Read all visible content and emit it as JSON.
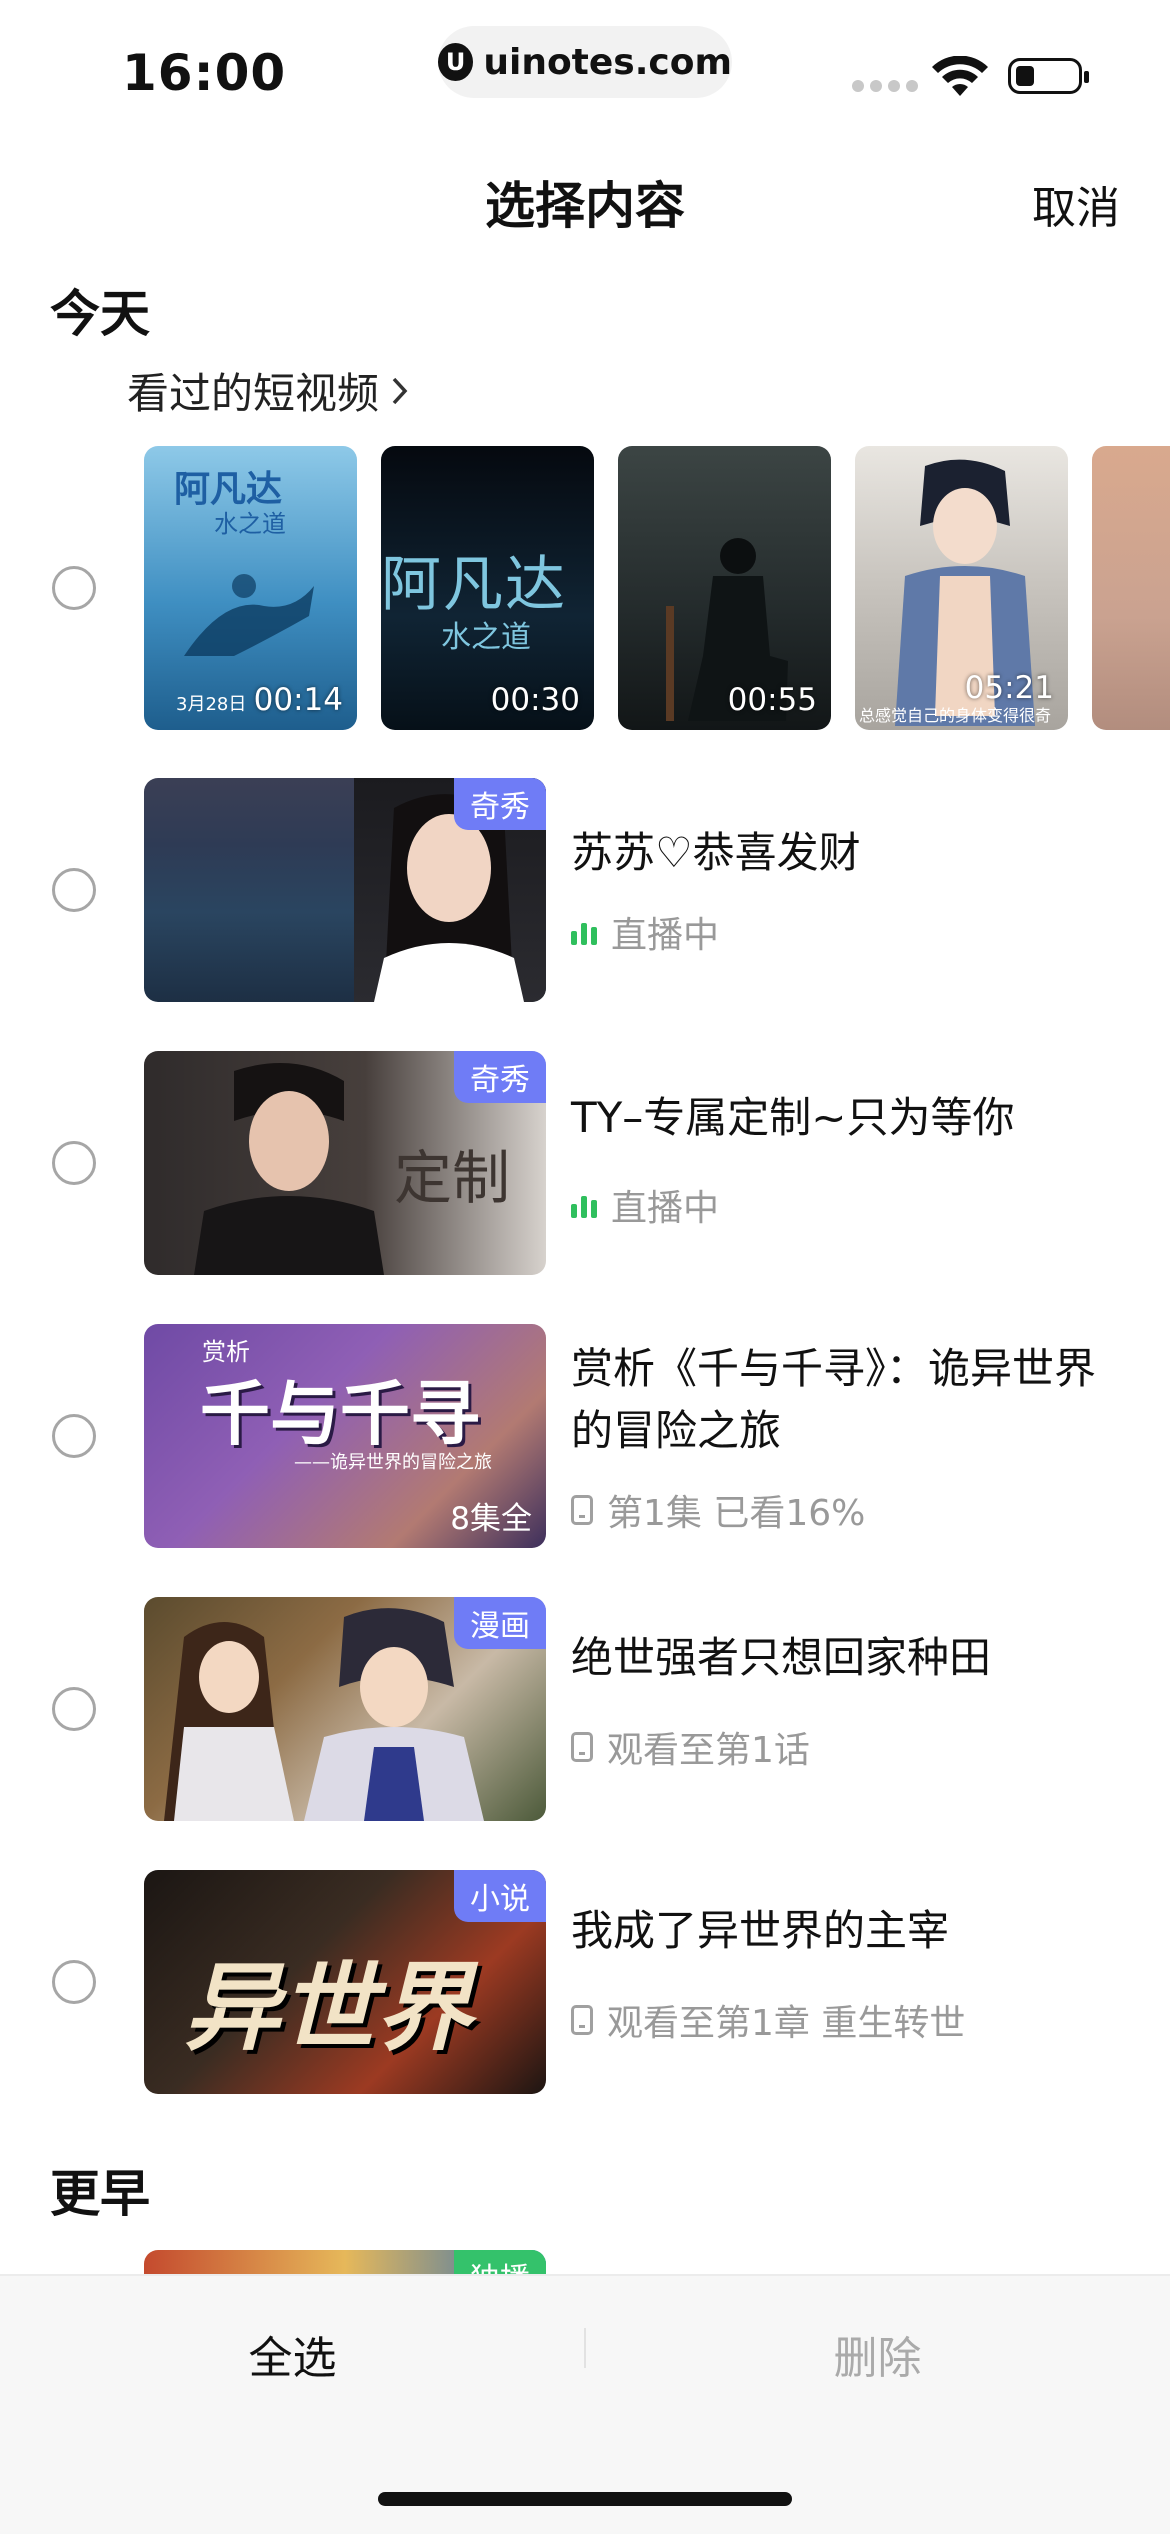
{
  "status_bar": {
    "time": "16:00",
    "url": "uinotes.com"
  },
  "nav": {
    "title": "选择内容",
    "cancel": "取消"
  },
  "sections": {
    "today": "今天",
    "earlier": "更早"
  },
  "short_videos": {
    "label": "看过的短视频",
    "items": [
      {
        "caption": "阿凡达",
        "subcaption": "水之道",
        "date": "3月28日",
        "duration": "00:14"
      },
      {
        "caption": "阿凡达",
        "subcaption": "水之道",
        "duration": "00:30"
      },
      {
        "duration": "00:55"
      },
      {
        "overlay_text": "总感觉自己的身体变得很奇",
        "duration": "05:21"
      },
      {}
    ]
  },
  "items": [
    {
      "badge": "奇秀",
      "title": "苏苏♡恭喜发财",
      "status": "直播中",
      "kind": "live"
    },
    {
      "badge": "奇秀",
      "title": "TY–专属定制~只为等你",
      "status": "直播中",
      "kind": "live",
      "thumb_text": "定制"
    },
    {
      "title": "赏析《千与千寻》：诡异世界的冒险之旅",
      "status": "第1集  已看16%",
      "kind": "video",
      "corner": "8集全",
      "thumb_text": "千与千寻",
      "thumb_tag": "赏析",
      "thumb_sub": "——诡异世界的冒险之旅"
    },
    {
      "badge": "漫画",
      "title": "绝世强者只想回家种田",
      "status": "观看至第1话",
      "kind": "comic"
    },
    {
      "badge": "小说",
      "title": "我成了异世界的主宰",
      "status": "观看至第1章  重生转世",
      "kind": "novel",
      "thumb_text": "异世界"
    }
  ],
  "earlier_item": {
    "badge": "独播"
  },
  "bottom": {
    "select_all": "全选",
    "delete": "删除"
  }
}
